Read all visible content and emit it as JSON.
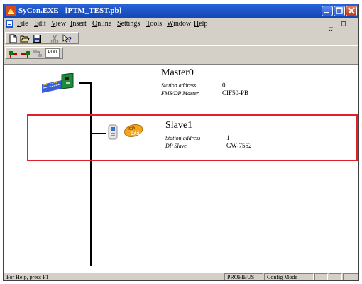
{
  "window": {
    "title": "SyCon.EXE - [PTM_TEST.pb]",
    "controls": {
      "minimize": "minimize-icon",
      "maximize": "maximize-icon",
      "close": "close-icon"
    }
  },
  "menu": {
    "items": [
      {
        "label": "File",
        "accel": "F",
        "rest": "ile"
      },
      {
        "label": "Edit",
        "accel": "E",
        "rest": "dit"
      },
      {
        "label": "View",
        "accel": "V",
        "rest": "iew"
      },
      {
        "label": "Insert",
        "accel": "I",
        "rest": "nsert"
      },
      {
        "label": "Online",
        "accel": "O",
        "rest": "nline"
      },
      {
        "label": "Settings",
        "accel": "S",
        "rest": "ettings"
      },
      {
        "label": "Tools",
        "accel": "T",
        "rest": "ools"
      },
      {
        "label": "Window",
        "accel": "W",
        "rest": "indow"
      },
      {
        "label": "Help",
        "accel": "H",
        "rest": "elp"
      }
    ],
    "mdi_controls": "_  □  ×"
  },
  "toolbar1": {
    "icons": [
      "new-file-icon",
      "open-folder-icon",
      "save-icon",
      "scissors-icon",
      "help-context-icon"
    ]
  },
  "toolbar2": {
    "icons": [
      "insert-master-icon",
      "insert-slave-icon",
      "device-assign-icon"
    ],
    "pdd_label": "PDD"
  },
  "master": {
    "name": "Master0",
    "station_address_label": "Station address",
    "station_address": "0",
    "type_label": "FMS/DP Master",
    "type_value": "CIF50-PB"
  },
  "slave": {
    "name": "Slave1",
    "station_address_label": "Station address",
    "station_address": "1",
    "type_label": "DP Slave",
    "type_value": "GW-7552"
  },
  "statusbar": {
    "help_text": "For Help, press F1",
    "protocol": "PROFIBUS",
    "mode": "Config Mode"
  },
  "colors": {
    "title_bar": "#1f56c9",
    "selection": "#e0202a",
    "face": "#d4d0c8"
  }
}
